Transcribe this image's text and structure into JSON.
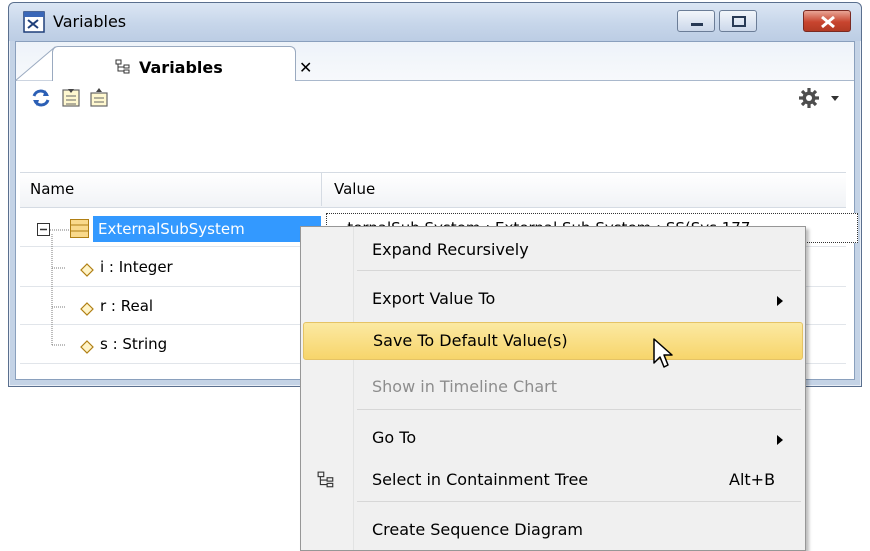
{
  "window": {
    "title": "Variables",
    "accent_close": "#c8452f"
  },
  "tab": {
    "label": "Variables",
    "close_glyph": "✕",
    "icon": "tree-icon"
  },
  "toolbar": {
    "icons": [
      "refresh-icon",
      "expand-all-icon",
      "collapse-all-icon",
      "gear-icon"
    ]
  },
  "table": {
    "columns": [
      "Name",
      "Value"
    ],
    "rows": [
      {
        "name": "ExternalSubSystem",
        "value": "...ternalSub System : External Sub System : SS(Sys 177",
        "selected": true,
        "icon": "block-icon"
      },
      {
        "name": "i : Integer",
        "icon": "property-icon"
      },
      {
        "name": "r : Real",
        "icon": "property-icon"
      },
      {
        "name": "s : String",
        "icon": "property-icon"
      }
    ]
  },
  "context_menu": {
    "items": [
      {
        "label": "Expand Recursively"
      },
      {
        "label": "Export Value To",
        "submenu": true
      },
      {
        "label": "Save To Default Value(s)",
        "highlighted": true
      },
      {
        "label": "Show in Timeline Chart",
        "disabled": true
      },
      {
        "label": "Go To",
        "submenu": true
      },
      {
        "label": "Select in Containment Tree",
        "shortcut": "Alt+B",
        "icon": "containment-tree-icon"
      },
      {
        "label": "Create Sequence Diagram"
      }
    ]
  }
}
